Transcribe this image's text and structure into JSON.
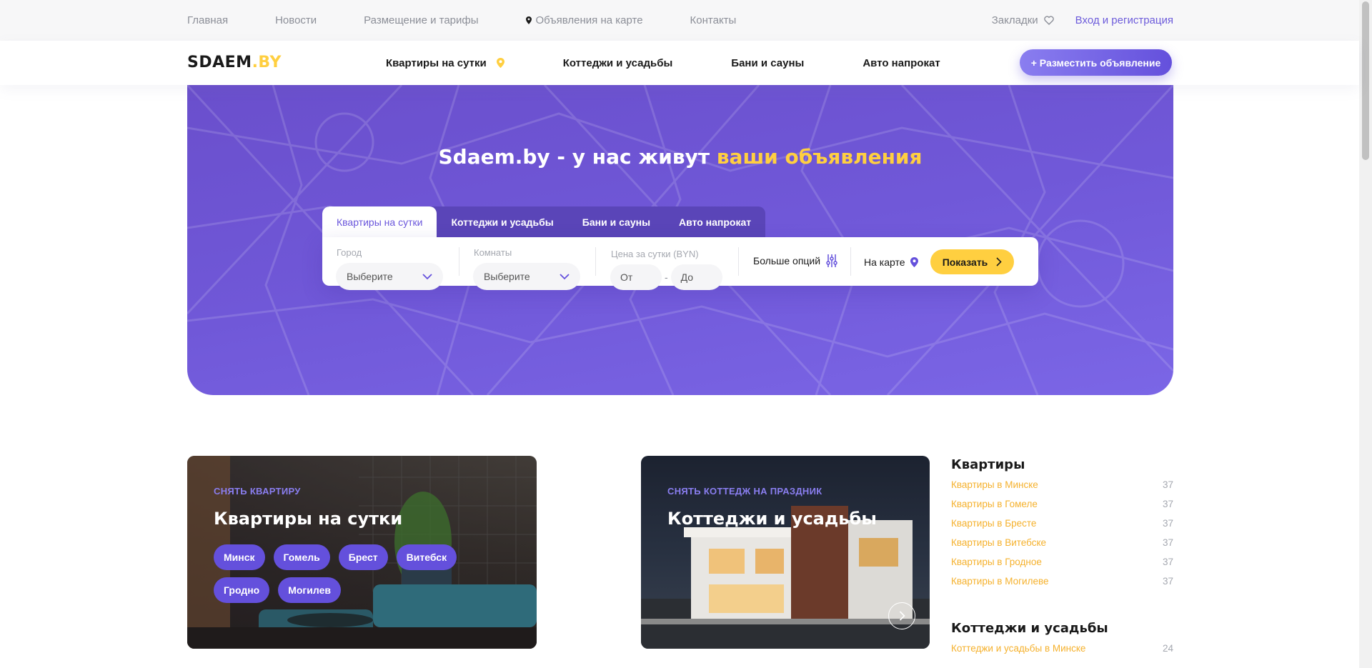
{
  "topnav": {
    "items": [
      "Главная",
      "Новости",
      "Размещение и тарифы",
      "Объявления на карте",
      "Контакты"
    ],
    "bookmarks": "Закладки",
    "login": "Вход и регистрация"
  },
  "header": {
    "logo_main": "SDAEM",
    "logo_accent": ".BY",
    "nav": [
      "Квартиры на сутки",
      "Коттеджи и усадьбы",
      "Бани и сауны",
      "Авто напрокат"
    ],
    "post_button": "+ Разместить объявление"
  },
  "hero": {
    "title_plain": "Sdaem.by - у нас живут ",
    "title_highlight": "ваши объявления",
    "tabs": [
      "Квартиры на сутки",
      "Коттеджи и усадьбы",
      "Бани и сауны",
      "Авто напрокат"
    ],
    "active_tab": 0,
    "search": {
      "city_label": "Город",
      "city_value": "Выберите",
      "rooms_label": "Комнаты",
      "rooms_value": "Выберите",
      "price_label": "Цена за сутки (BYN)",
      "price_from": "От",
      "price_dash": "-",
      "price_to": "До",
      "more_options": "Больше опций",
      "on_map": "На карте",
      "show_button": "Показать"
    }
  },
  "cards": [
    {
      "kicker": "Снять квартиру",
      "title": "Квартиры на сутки",
      "chips": [
        "Минск",
        "Гомель",
        "Брест",
        "Витебск",
        "Гродно",
        "Могилев"
      ]
    },
    {
      "kicker": "Снять коттедж на праздник",
      "title": "Коттеджи и усадьбы"
    }
  ],
  "links": {
    "apartments": {
      "title": "Квартиры",
      "items": [
        {
          "name": "Квартиры в Минске",
          "count": "37"
        },
        {
          "name": "Квартиры в Гомеле",
          "count": "37"
        },
        {
          "name": "Квартиры в Бресте",
          "count": "37"
        },
        {
          "name": "Квартиры в Витебске",
          "count": "37"
        },
        {
          "name": "Квартиры в Гродное",
          "count": "37"
        },
        {
          "name": "Квартиры в Могилеве",
          "count": "37"
        }
      ]
    },
    "cottages": {
      "title": "Коттеджи и усадьбы",
      "items": [
        {
          "name": "Коттеджи и усадьбы в Минске",
          "count": "24"
        }
      ]
    }
  },
  "colors": {
    "brand_purple": "#6450dc",
    "brand_yellow": "#ffcf40",
    "link_orange": "#f5b12d"
  }
}
